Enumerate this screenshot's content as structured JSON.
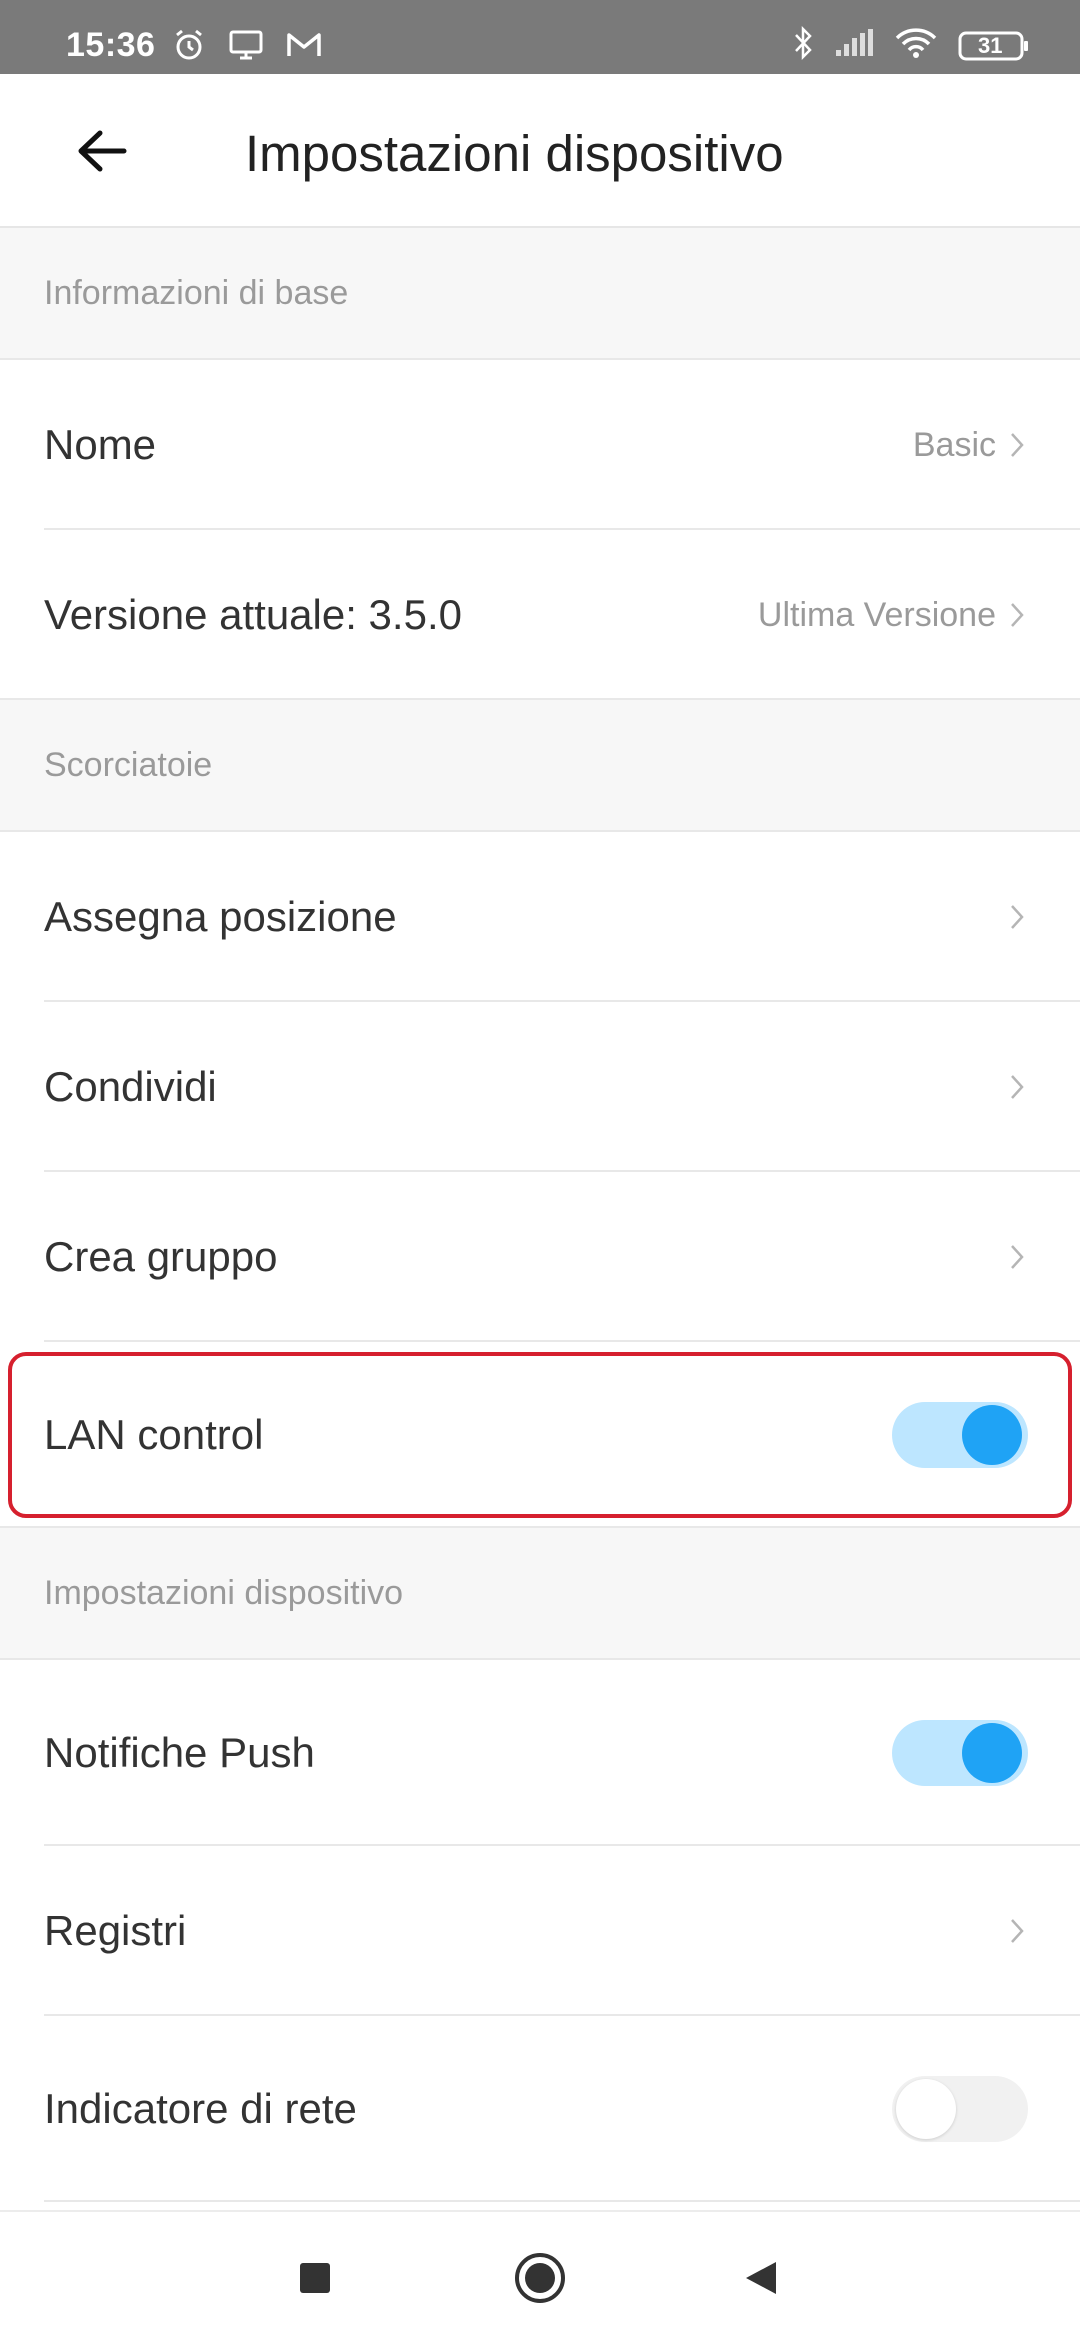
{
  "status_bar": {
    "time": "15:36",
    "left_icons": [
      "alarm-icon",
      "screen-cast-icon",
      "gmail-icon"
    ],
    "right_icons": [
      "bluetooth-icon",
      "signal-icon",
      "wifi-icon",
      "battery-icon"
    ],
    "battery": "31"
  },
  "header": {
    "title": "Impostazioni dispositivo",
    "back_icon": "arrow-left-icon"
  },
  "sections": {
    "basic_info": {
      "title": "Informazioni di base",
      "name_label": "Nome",
      "name_value": "Basic",
      "version_label": "Versione attuale:  3.5.0",
      "version_value": "Ultima Versione"
    },
    "shortcuts": {
      "title": "Scorciatoie",
      "assign_location": "Assegna posizione",
      "share": "Condividi",
      "create_group": "Crea gruppo",
      "lan_control": "LAN control",
      "lan_control_on": true
    },
    "device_settings": {
      "title": "Impostazioni dispositivo",
      "push_notifications": "Notifiche Push",
      "push_notifications_on": true,
      "logs": "Registri",
      "network_indicator": "Indicatore di rete",
      "network_indicator_on": false
    }
  },
  "colors": {
    "accent": "#1fa3f5",
    "toggle_on_track": "#bde6ff",
    "highlight": "#d6202e"
  },
  "nav_bar": [
    "recents-icon",
    "home-icon",
    "back-icon"
  ]
}
